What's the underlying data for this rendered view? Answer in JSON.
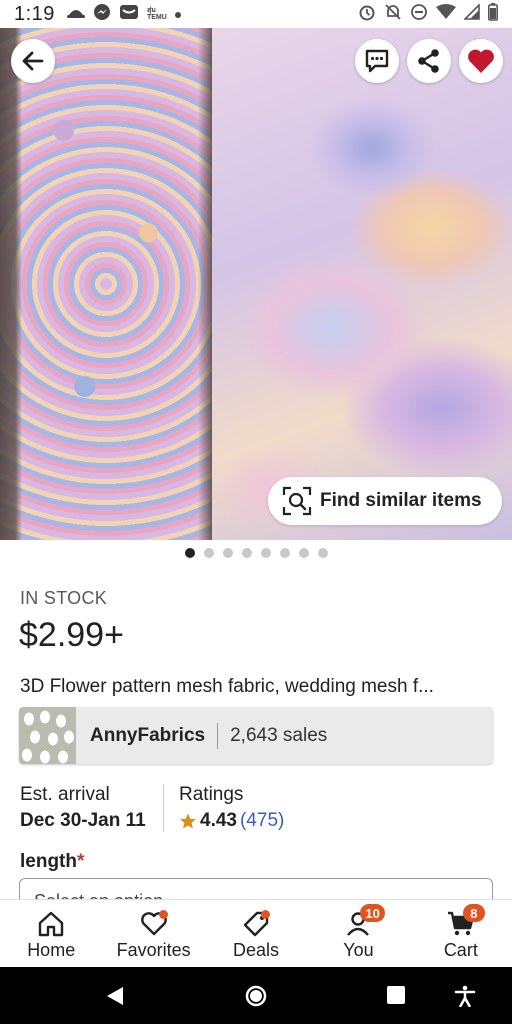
{
  "status_bar": {
    "time": "1:19",
    "temu_icon_text_top": "สุ่ม",
    "temu_icon_text_bottom": "TEMU"
  },
  "hero": {
    "find_similar_label": "Find similar items",
    "image_count": 8,
    "active_index": 0
  },
  "product": {
    "stock_status": "IN STOCK",
    "price": "$2.99+",
    "title": "3D Flower pattern mesh fabric, wedding mesh f..."
  },
  "shop": {
    "name": "AnnyFabrics",
    "sales": "2,643 sales"
  },
  "meta": {
    "arrival_label": "Est. arrival",
    "arrival_value": "Dec 30-Jan 11",
    "ratings_label": "Ratings",
    "rating_score": "4.43",
    "rating_count": "(475)"
  },
  "variation": {
    "label": "length",
    "required_mark": "*",
    "select_placeholder": "Select an option"
  },
  "bottom_nav": {
    "items": [
      {
        "label": "Home"
      },
      {
        "label": "Favorites"
      },
      {
        "label": "Deals"
      },
      {
        "label": "You",
        "badge": "10"
      },
      {
        "label": "Cart",
        "badge": "8"
      }
    ]
  },
  "colors": {
    "accent_orange": "#e2541f",
    "heart_red": "#c0182e",
    "link_blue": "#3b5bbd",
    "star_gold": "#d9901a"
  }
}
